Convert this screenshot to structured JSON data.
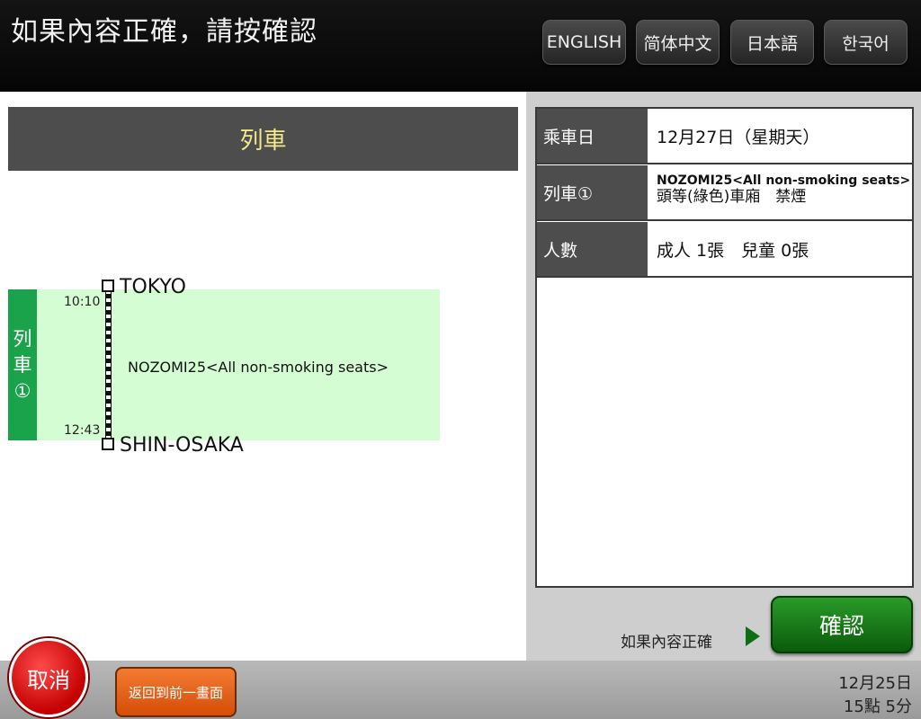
{
  "header": {
    "title": "如果內容正確，請按確認",
    "languages": [
      "ENGLISH",
      "简体中文",
      "日本語",
      "한국어"
    ]
  },
  "left": {
    "section_title": "列車",
    "leg_tag": [
      "列",
      "車",
      "①"
    ],
    "origin": {
      "name": "TOKYO",
      "time": "10:10"
    },
    "destination": {
      "name": "SHIN-OSAKA",
      "time": "12:43"
    },
    "train_name": "NOZOMI25<All non-smoking seats>"
  },
  "info": {
    "rows": [
      {
        "label": "乘車日",
        "value": "12月27日（星期天）"
      },
      {
        "label": "列車①",
        "value_line1": "NOZOMI25<All non-smoking seats>",
        "value_line2": "頭等(綠色)車廂　禁煙"
      },
      {
        "label": "人數",
        "value": "成人 1張　兒童 0張"
      }
    ]
  },
  "confirm": {
    "hint": "如果內容正確",
    "button_label": "確認"
  },
  "bottom": {
    "cancel_label": "取消",
    "back_label": "返回到前一畫面",
    "date": "12月25日",
    "time": "15點 5分"
  },
  "colors": {
    "leg_green": "#1aa34a",
    "leg_band": "#d4fdd4",
    "confirm_green": "#0f7a14",
    "cancel_red": "#d40000",
    "back_orange": "#e8621a",
    "header_gold": "#f2e98a"
  }
}
